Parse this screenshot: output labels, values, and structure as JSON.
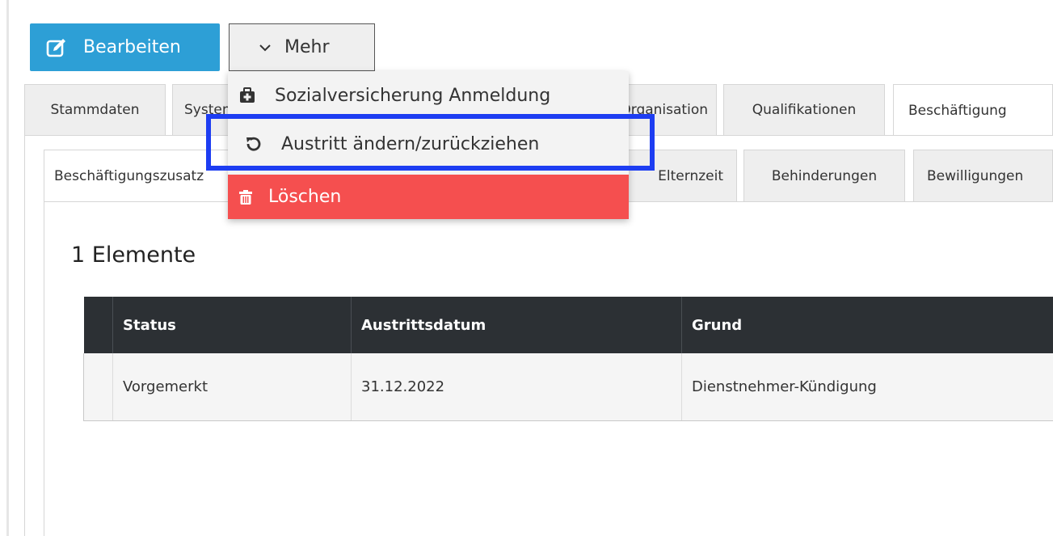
{
  "toolbar": {
    "edit_label": "Bearbeiten",
    "more_label": "Mehr"
  },
  "outer_tabs": [
    {
      "label": "Stammdaten",
      "active": false
    },
    {
      "label": "System",
      "active": false
    },
    {
      "label": "Organisation",
      "active": false
    },
    {
      "label": "Qualifikationen",
      "active": false
    },
    {
      "label": "Beschäftigung",
      "active": true
    }
  ],
  "inner_tabs": [
    {
      "label": "Beschäftigungszusatz"
    },
    {
      "label": "Elternzeit"
    },
    {
      "label": "Behinderungen"
    },
    {
      "label": "Bewilligungen"
    }
  ],
  "dropdown": {
    "items": [
      {
        "label": "Sozialversicherung Anmeldung",
        "icon": "medkit-icon"
      },
      {
        "label": "Austritt ändern/zurückziehen",
        "icon": "undo-icon"
      },
      {
        "label": "Löschen",
        "icon": "trash-icon"
      }
    ]
  },
  "count_heading": "1 Elemente",
  "table": {
    "columns": [
      "Status",
      "Austrittsdatum",
      "Grund"
    ],
    "rows": [
      [
        "Vorgemerkt",
        "31.12.2022",
        "Dienstnehmer-Kündigung"
      ]
    ]
  },
  "colors": {
    "primary": "#2d9fd6",
    "danger": "#f54f4f",
    "table_header": "#2c3034",
    "highlight": "#1d3df2"
  }
}
